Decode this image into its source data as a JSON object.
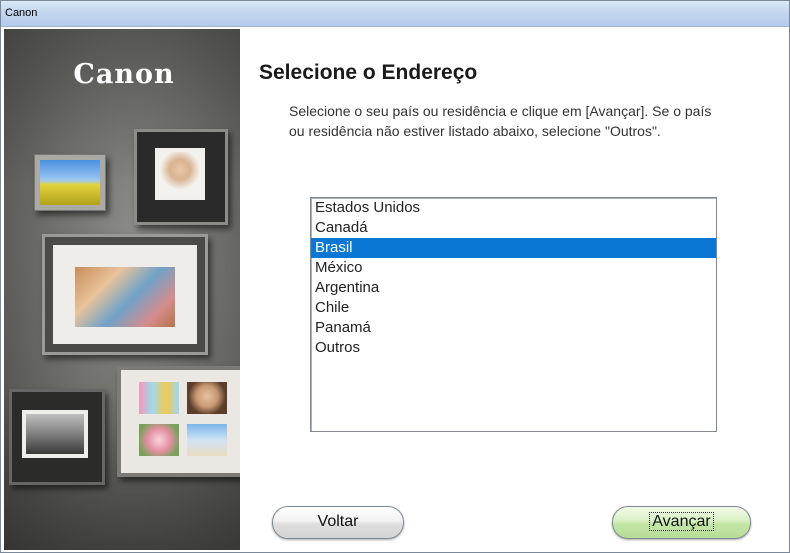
{
  "window": {
    "title": "Canon"
  },
  "brand": {
    "logo_text": "Canon"
  },
  "main": {
    "title": "Selecione o Endereço",
    "description": "Selecione o seu país ou residência e clique em [Avançar]. Se o país ou residência não estiver listado abaixo, selecione \"Outros\"."
  },
  "country_list": {
    "selected": "Brasil",
    "items": [
      {
        "label": "Estados Unidos"
      },
      {
        "label": "Canadá"
      },
      {
        "label": "Brasil"
      },
      {
        "label": "México"
      },
      {
        "label": "Argentina"
      },
      {
        "label": "Chile"
      },
      {
        "label": "Panamá"
      },
      {
        "label": "Outros"
      }
    ]
  },
  "buttons": {
    "back_label": "Voltar",
    "next_label": "Avançar"
  },
  "colors": {
    "selection": "#0a77d5",
    "titlebar": "#c3d6ee",
    "next_button": "#c3e6a6"
  }
}
